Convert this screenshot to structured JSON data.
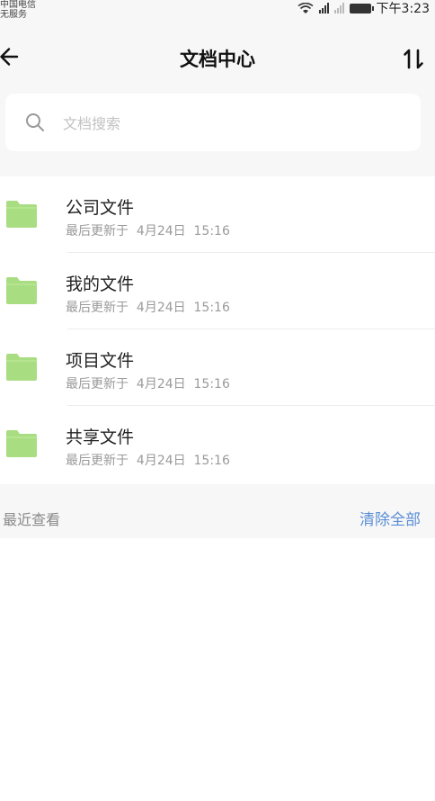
{
  "status_bar": {
    "carrier_line1": "中国电信",
    "carrier_line2": "无服务",
    "time": "下午3:23"
  },
  "header": {
    "title": "文档中心",
    "back_icon": "arrow-left-icon",
    "sort_icon": "sort-icon"
  },
  "search": {
    "placeholder": "文档搜索",
    "value": "",
    "icon": "search-icon"
  },
  "folders": [
    {
      "name": "公司文件",
      "updated_prefix": "最后更新于",
      "updated_time": "4月24日  15:16",
      "icon": "folder-icon",
      "color": "#a9dd82"
    },
    {
      "name": "我的文件",
      "updated_prefix": "最后更新于",
      "updated_time": "4月24日  15:16",
      "icon": "folder-icon",
      "color": "#a9dd82"
    },
    {
      "name": "项目文件",
      "updated_prefix": "最后更新于",
      "updated_time": "4月24日  15:16",
      "icon": "folder-icon",
      "color": "#a9dd82"
    },
    {
      "name": "共享文件",
      "updated_prefix": "最后更新于",
      "updated_time": "4月24日  15:16",
      "icon": "folder-icon",
      "color": "#a9dd82"
    }
  ],
  "recent": {
    "label": "最近查看",
    "clear_label": "清除全部"
  },
  "colors": {
    "background": "#f7f7f7",
    "accent": "#5b8ed6",
    "folder": "#a9dd82"
  }
}
